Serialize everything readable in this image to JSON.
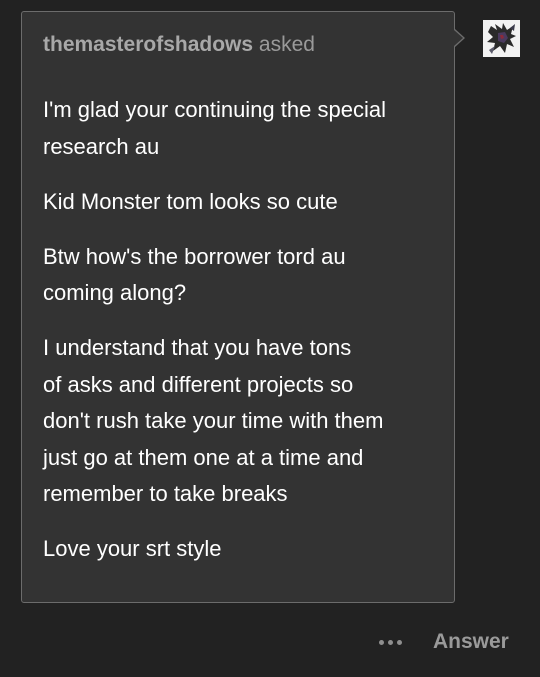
{
  "ask": {
    "asker_name": "themasterofshadows",
    "asked_label": "asked",
    "paragraphs": [
      "I'm glad your continuing the special\nresearch au",
      "Kid Monster tom looks so cute",
      "Btw how's the borrower tord au\ncoming along?",
      "I understand that you have tons\nof asks and different projects so\ndon't rush take your time with them\njust go at them one at a time and\nremember to take breaks",
      "Love your srt style"
    ]
  },
  "actions": {
    "more_icon": "ellipsis-icon",
    "answer_label": "Answer"
  },
  "colors": {
    "background": "#222222",
    "card": "#333333",
    "card_border": "#6c6c6c",
    "text": "#ffffff",
    "muted": "#9a9a9a"
  }
}
